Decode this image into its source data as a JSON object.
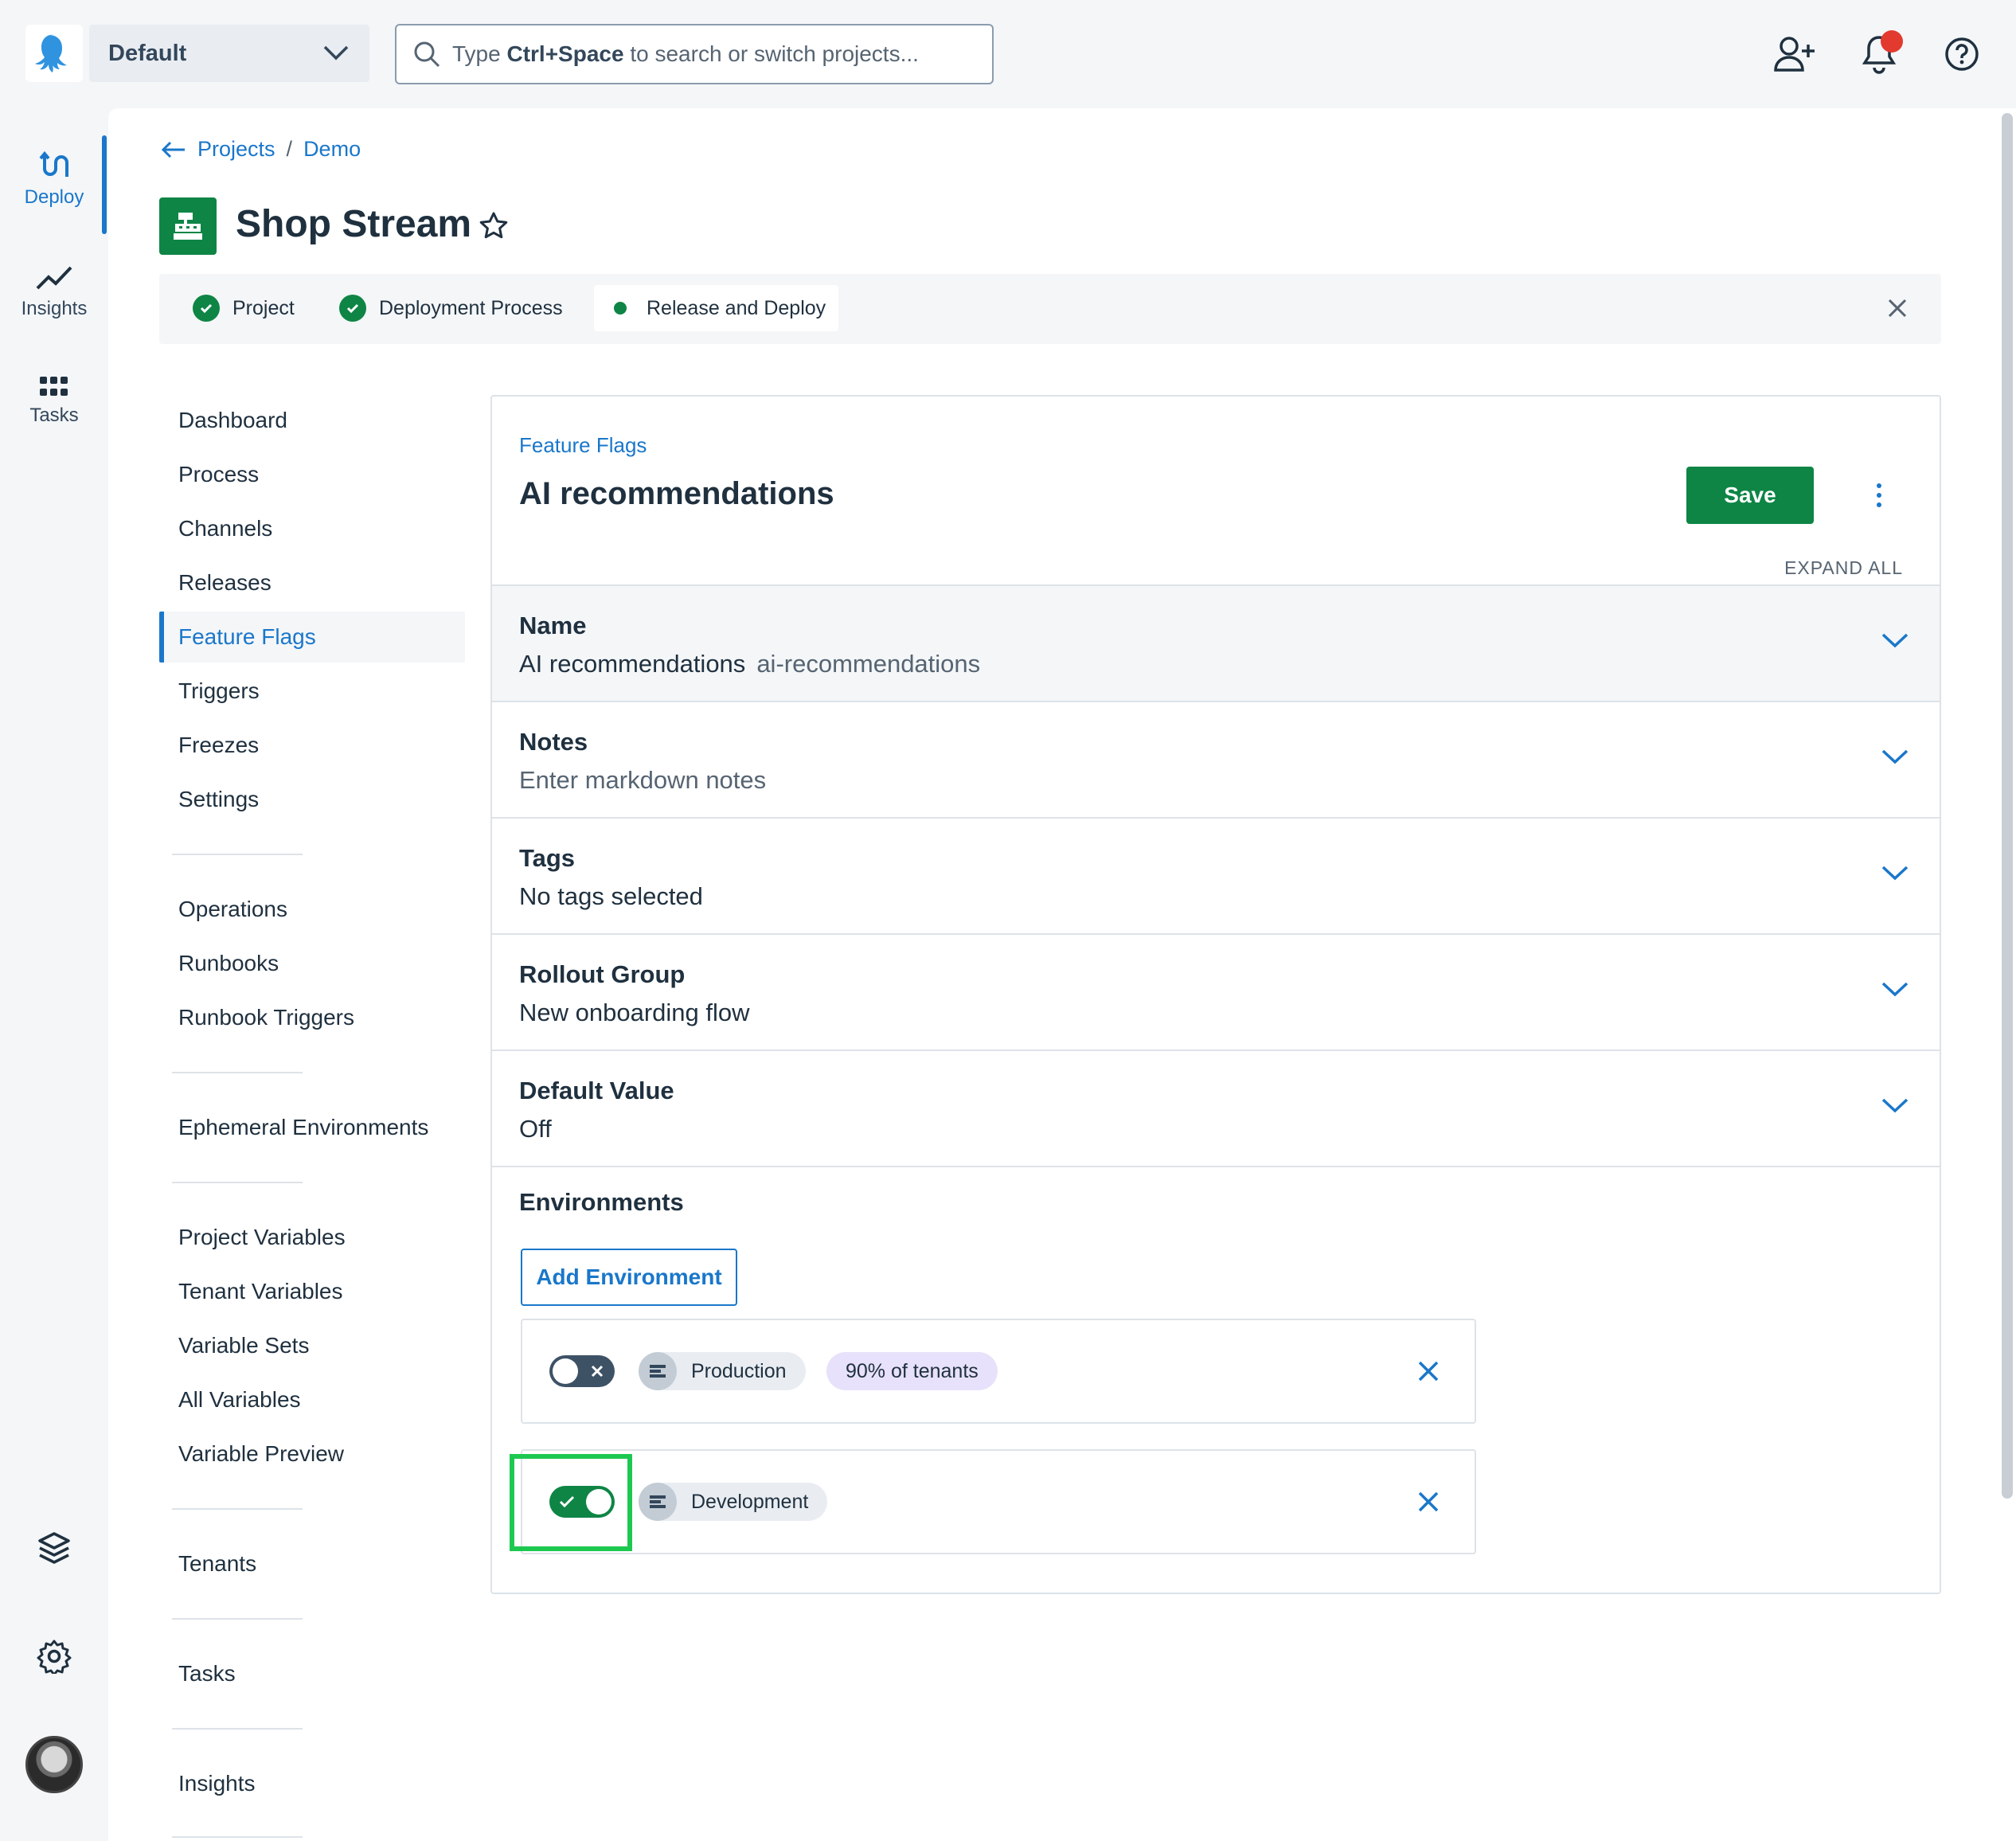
{
  "topbar": {
    "space_name": "Default",
    "search_placeholder_prefix": "Type ",
    "search_placeholder_key": "Ctrl+Space",
    "search_placeholder_suffix": " to search or switch projects..."
  },
  "rail": {
    "items": [
      {
        "label": "Deploy",
        "icon": "deploy-icon",
        "active": true
      },
      {
        "label": "Insights",
        "icon": "insights-icon",
        "active": false
      },
      {
        "label": "Tasks",
        "icon": "tasks-icon",
        "active": false
      }
    ]
  },
  "breadcrumb": {
    "projects": "Projects",
    "separator": "/",
    "group": "Demo"
  },
  "project": {
    "title": "Shop Stream"
  },
  "steps": [
    {
      "label": "Project",
      "state": "done"
    },
    {
      "label": "Deployment Process",
      "state": "done"
    },
    {
      "label": "Release and Deploy",
      "state": "current"
    }
  ],
  "subnav": {
    "group1": [
      "Dashboard",
      "Process",
      "Channels",
      "Releases",
      "Feature Flags",
      "Triggers",
      "Freezes",
      "Settings"
    ],
    "group2": [
      "Operations",
      "Runbooks",
      "Runbook Triggers"
    ],
    "group3": [
      "Ephemeral Environments"
    ],
    "group4": [
      "Project Variables",
      "Tenant Variables",
      "Variable Sets",
      "All Variables",
      "Variable Preview"
    ],
    "group5": [
      "Tenants"
    ],
    "group6": [
      "Tasks"
    ],
    "group7": [
      "Insights"
    ],
    "active": "Feature Flags"
  },
  "flag": {
    "crumb": "Feature Flags",
    "title": "AI recommendations",
    "save_label": "Save",
    "expand_all": "EXPAND ALL",
    "sections": {
      "name": {
        "title": "Name",
        "value": "AI recommendations",
        "slug": "ai-recommendations"
      },
      "notes": {
        "title": "Notes",
        "value": "Enter markdown notes"
      },
      "tags": {
        "title": "Tags",
        "value": "No tags selected"
      },
      "rollout": {
        "title": "Rollout Group",
        "value": "New onboarding flow"
      },
      "default": {
        "title": "Default Value",
        "value": "Off"
      }
    },
    "environments": {
      "title": "Environments",
      "add_label": "Add Environment",
      "rows": [
        {
          "name": "Production",
          "enabled": false,
          "tenants": "90% of tenants"
        },
        {
          "name": "Development",
          "enabled": true
        }
      ]
    }
  },
  "colors": {
    "accent": "#1a77ca",
    "success": "#0e8545",
    "highlight": "#1dc851",
    "notification": "#e33a2f"
  }
}
